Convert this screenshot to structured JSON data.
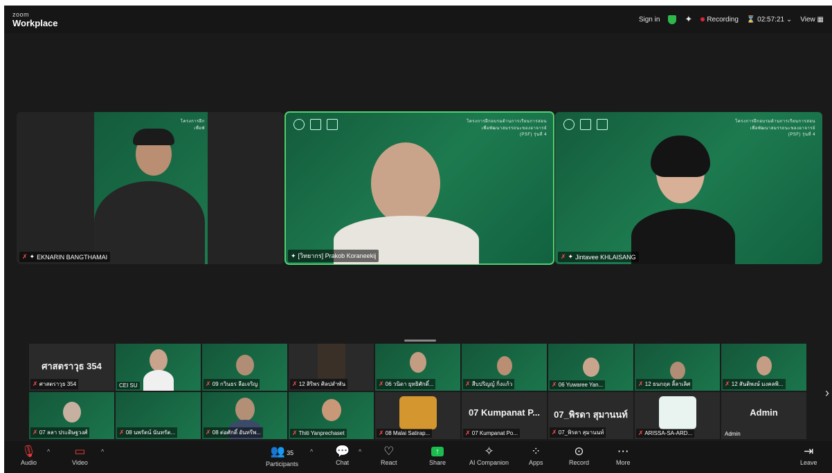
{
  "app": {
    "brand_small": "zoom",
    "brand_large": "Workplace"
  },
  "top": {
    "sign_in": "Sign in",
    "recording": "Recording",
    "timer": "02:57:21",
    "view": "View"
  },
  "stage": [
    {
      "name": "EKNARIN BANGTHAMAI",
      "hdr1": "โครงการฝึก",
      "hdr2": "เพื่อพั"
    },
    {
      "name": "[วิทยากร] Prakob Koraneekij",
      "hdr1": "โครงการฝึกอบรมด้านการเรียนการสอน",
      "hdr2": "เพื่อพัฒนาสมรรถนะของอาจารย์",
      "hdr3": "(PSF) รุ่นที่ 4"
    },
    {
      "name": "Jintavee KHLAISANG",
      "hdr1": "โครงการฝึกอบรมด้านการเรียนการสอน",
      "hdr2": "เพื่อพัฒนาสมรรถนะของอาจารย์",
      "hdr3": "(PSF) รุ่นที่ 4"
    }
  ],
  "gallery": [
    {
      "big": "ศาสตราวุธ 354",
      "label": "ศาสตราวุธ 354"
    },
    {
      "label": "CEI SU"
    },
    {
      "label": "09 กวินธร ลือเจริญ"
    },
    {
      "label": "12 สิริพร ศิลปสำพัน"
    },
    {
      "label": "06 วนิดา ยุทธิศักดิ์..."
    },
    {
      "label": "สืบปริญญ์ กิ่งแก้ว"
    },
    {
      "label": "06 Yuwaree Yan..."
    },
    {
      "label": "12 ธนกฤต ลี้ลาเลิศ"
    },
    {
      "label": "12 สันติพงษ์ มงคลพิ..."
    },
    {
      "label": "07 ลลา ประดิษฐวงศ์"
    },
    {
      "label": "08 นพรัตน์ นันทรัต..."
    },
    {
      "label": "08 ต่อศักดิ์ อันทรีพ..."
    },
    {
      "label": "Thiti Yanprechaset"
    },
    {
      "label": "08 Malai Satirap..."
    },
    {
      "big": "07 Kumpanat P...",
      "label": "07 Kumpanat Po..."
    },
    {
      "big": "07_พิรดา สุมานนท์",
      "label": "07_พิรดา สุมานนท์"
    },
    {
      "label": "ARISSA-SA-ARD..."
    },
    {
      "big": "Admin",
      "label": "Admin"
    }
  ],
  "toolbar": {
    "audio": "Audio",
    "video": "Video",
    "participants": "Participants",
    "participants_count": "35",
    "chat": "Chat",
    "react": "React",
    "share": "Share",
    "ai": "AI Companion",
    "apps": "Apps",
    "record": "Record",
    "more": "More",
    "leave": "Leave"
  }
}
